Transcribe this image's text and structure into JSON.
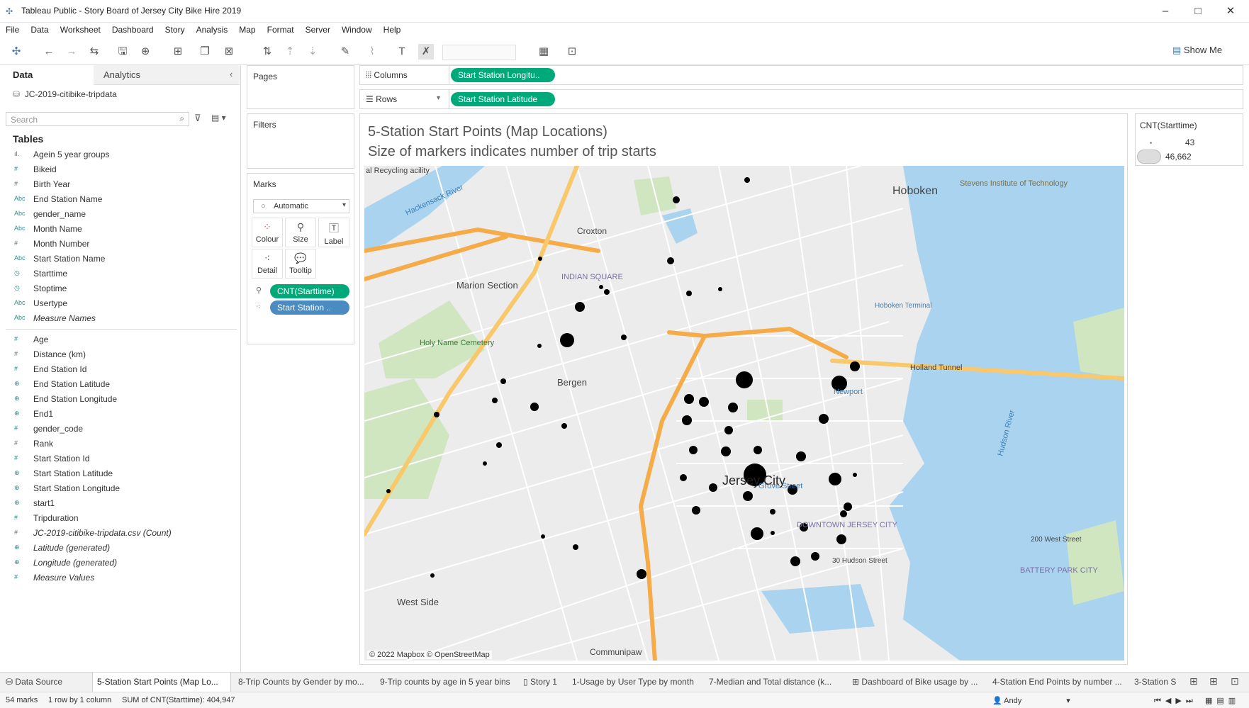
{
  "window": {
    "title": "Tableau Public - Story Board of Jersey City Bike Hire 2019",
    "minimize": "–",
    "maximize": "□",
    "close": "✕"
  },
  "menu": [
    "File",
    "Data",
    "Worksheet",
    "Dashboard",
    "Story",
    "Analysis",
    "Map",
    "Format",
    "Server",
    "Window",
    "Help"
  ],
  "toolbar": {
    "show_me": "Show Me"
  },
  "left_panel": {
    "tab_data": "Data",
    "tab_analytics": "Analytics",
    "datasource": "JC-2019-citibike-tripdata",
    "search_placeholder": "Search",
    "tables_heading": "Tables",
    "dimensions": [
      {
        "type": "ıl.",
        "name": "Agein 5 year groups"
      },
      {
        "type": "#",
        "name": "Bikeid"
      },
      {
        "type": "#",
        "name": "Birth Year"
      },
      {
        "type": "Abc",
        "name": "End Station Name"
      },
      {
        "type": "Abc",
        "name": "gender_name"
      },
      {
        "type": "Abc",
        "name": "Month Name"
      },
      {
        "type": "#",
        "name": "Month Number"
      },
      {
        "type": "Abc",
        "name": "Start Station Name"
      },
      {
        "type": "◷",
        "name": "Starttime"
      },
      {
        "type": "◷",
        "name": "Stoptime"
      },
      {
        "type": "Abc",
        "name": "Usertype"
      },
      {
        "type": "Abc",
        "name": "Measure Names",
        "italic": true
      }
    ],
    "measures": [
      {
        "type": "#",
        "name": "Age"
      },
      {
        "type": "#",
        "name": "Distance  (km)"
      },
      {
        "type": "#",
        "name": "End Station Id"
      },
      {
        "type": "⊕",
        "name": "End Station Latitude"
      },
      {
        "type": "⊕",
        "name": "End Station Longitude"
      },
      {
        "type": "⊕",
        "name": "End1"
      },
      {
        "type": "#",
        "name": "gender_code"
      },
      {
        "type": "#",
        "name": "Rank"
      },
      {
        "type": "#",
        "name": "Start Station Id"
      },
      {
        "type": "⊕",
        "name": "Start Station Latitude"
      },
      {
        "type": "⊕",
        "name": "Start Station Longitude"
      },
      {
        "type": "⊕",
        "name": "start1"
      },
      {
        "type": "#",
        "name": "Tripduration"
      },
      {
        "type": "#",
        "name": "JC-2019-citibike-tripdata.csv (Count)",
        "italic": true
      },
      {
        "type": "⊕",
        "name": "Latitude (generated)",
        "italic": true
      },
      {
        "type": "⊕",
        "name": "Longitude (generated)",
        "italic": true
      },
      {
        "type": "#",
        "name": "Measure Values",
        "italic": true
      }
    ]
  },
  "cards": {
    "pages": "Pages",
    "filters": "Filters",
    "marks": "Marks",
    "marks_type": "Automatic",
    "buttons": {
      "colour": "Colour",
      "size": "Size",
      "label": "Label",
      "detail": "Detail",
      "tooltip": "Tooltip"
    },
    "pill_size": "CNT(Starttime)",
    "pill_detail": "Start Station .."
  },
  "shelves": {
    "columns_label": "Columns",
    "columns_pill": "Start Station Longitu..",
    "rows_label": "Rows",
    "rows_pill": "Start Station Latitude"
  },
  "view": {
    "title": "5-Station Start Points (Map Locations)",
    "subtitle": "Size of markers indicates number of trip starts",
    "attribution": "© 2022 Mapbox © OpenStreetMap",
    "labels": {
      "hoboken": "Hoboken",
      "jersey_city": "Jersey City",
      "bergen": "Bergen",
      "west_side": "West Side",
      "marion": "Marion Section",
      "indian_square": "INDIAN SQUARE",
      "holy_name": "Holy Name Cemetery",
      "downtown": "DOWNTOWN JERSEY CITY",
      "croxton": "Croxton",
      "communipaw": "Communipaw",
      "hudson_river": "Hudson River",
      "holland_tunnel": "Holland Tunnel",
      "newport": "Newport",
      "grove_street": "Grove Street",
      "battery_park": "BATTERY PARK CITY",
      "stevens": "Stevens Institute of Technology",
      "hoboken_terminal": "Hoboken Terminal",
      "west_street": "200 West Street",
      "hudson_street": "30 Hudson Street",
      "recycling": "al Recycling acility",
      "hackensack": "Hackensack River"
    },
    "colors": {
      "water": "#a9d3ee",
      "park": "#cfe6c0",
      "road": "#f6ab49",
      "land": "#ececec"
    }
  },
  "legend": {
    "title": "CNT(Starttime)",
    "min": "43",
    "max": "46,662"
  },
  "sheet_tabs": [
    "Data Source",
    "5-Station Start Points (Map Lo...",
    "8-Trip Counts by Gender by mo...",
    "9-Trip counts by age in 5 year bins",
    "Story 1",
    "1-Usage by User Type by month",
    "7-Median and Total distance (k...",
    "Dashboard of  Bike usage by ...",
    "4-Station End Points by number ...",
    "3-Station S"
  ],
  "status": {
    "marks": "54 marks",
    "rows_cols": "1 row by 1 column",
    "sum": "SUM of CNT(Starttime): 404,947",
    "user": "Andy"
  }
}
